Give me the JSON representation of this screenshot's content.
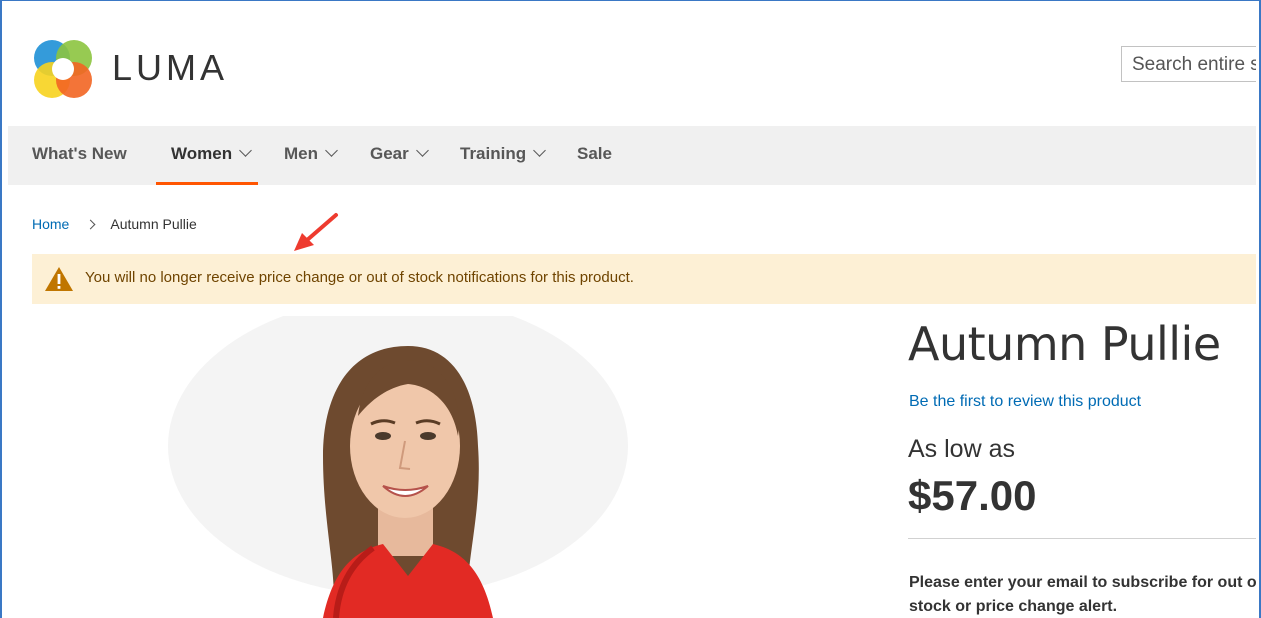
{
  "header": {
    "logo_text": "LUMA",
    "search_placeholder": "Search entire store here..."
  },
  "nav": {
    "items": [
      {
        "label": "What's New"
      },
      {
        "label": "Women"
      },
      {
        "label": "Men"
      },
      {
        "label": "Gear"
      },
      {
        "label": "Training"
      },
      {
        "label": "Sale"
      }
    ],
    "active": "Women"
  },
  "breadcrumb": {
    "home": "Home",
    "current": "Autumn Pullie"
  },
  "notice": {
    "text": "You will no longer receive price change or out of stock notifications for this product."
  },
  "product": {
    "title": "Autumn Pullie",
    "review_link": "Be the first to review this product",
    "price_prefix": "As low as",
    "price": "$57.00",
    "alert_prompt": "Please enter your email to subscribe for out of stock or price change alert."
  },
  "colors": {
    "link": "#006bb4",
    "accent": "#ff5501",
    "notice_bg": "#fdf0d5",
    "notice_text": "#6f4400",
    "nav_bg": "#f0f0f0"
  }
}
